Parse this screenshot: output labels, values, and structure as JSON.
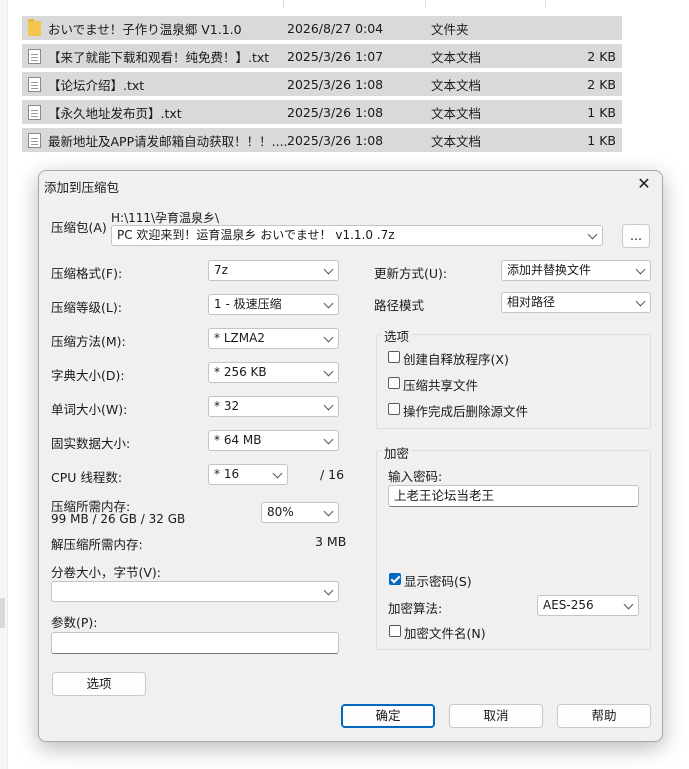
{
  "explorer": {
    "files": [
      {
        "name": "おいでませ！子作り温泉郷 V1.1.0",
        "date": "2026/8/27 0:04",
        "type": "文件夹",
        "size": "",
        "icon": "folder-icon"
      },
      {
        "name": "【来了就能下载和观看！纯免费！】.txt",
        "date": "2025/3/26 1:07",
        "type": "文本文档",
        "size": "2 KB",
        "icon": "text-file-icon"
      },
      {
        "name": "【论坛介绍】.txt",
        "date": "2025/3/26 1:08",
        "type": "文本文档",
        "size": "2 KB",
        "icon": "text-file-icon"
      },
      {
        "name": "【永久地址发布页】.txt",
        "date": "2025/3/26 1:08",
        "type": "文本文档",
        "size": "1 KB",
        "icon": "text-file-icon"
      },
      {
        "name": "最新地址及APP请发邮箱自动获取！！！....",
        "date": "2025/3/26 1:08",
        "type": "文本文档",
        "size": "1 KB",
        "icon": "text-file-icon"
      }
    ]
  },
  "dialog": {
    "title": "添加到压缩包",
    "close_glyph": "✕",
    "archive": {
      "label": "压缩包(A)",
      "path": "H:\\111\\孕育温泉乡\\",
      "filename": "PC 欢迎来到！运育温泉乡 おいでませ！ v1.1.0 .7z",
      "browse_label": "..."
    },
    "format": {
      "label": "压缩格式(F):",
      "value": "7z"
    },
    "level": {
      "label": "压缩等级(L):",
      "value": "1 - 极速压缩"
    },
    "method": {
      "label": "压缩方法(M):",
      "value": "*  LZMA2"
    },
    "dict": {
      "label": "字典大小(D):",
      "value": "*  256 KB"
    },
    "word": {
      "label": "单词大小(W):",
      "value": "*  32"
    },
    "solid": {
      "label": "固实数据大小:",
      "value": "*  64 MB"
    },
    "threads": {
      "label": "CPU 线程数:",
      "value": "*  16",
      "max": "/ 16"
    },
    "mem_compress": {
      "label": "压缩所需内存:",
      "detail": "99 MB / 26 GB / 32 GB",
      "percent": "80%"
    },
    "mem_decompress": {
      "label": "解压缩所需内存:",
      "value": "3 MB"
    },
    "volume": {
      "label": "分卷大小，字节(V):",
      "value": ""
    },
    "params": {
      "label": "参数(P):",
      "value": ""
    },
    "options_button": "选项",
    "update_mode": {
      "label": "更新方式(U):",
      "value": "添加并替换文件"
    },
    "path_mode": {
      "label": "路径模式",
      "value": "相对路径"
    },
    "options_group": {
      "title": "选项",
      "sfx": {
        "label": "创建自释放程序(X)",
        "checked": false
      },
      "shared": {
        "label": "压缩共享文件",
        "checked": false
      },
      "delete_after": {
        "label": "操作完成后删除源文件",
        "checked": false
      }
    },
    "encryption": {
      "title": "加密",
      "password_label": "输入密码:",
      "password": "上老王论坛当老王",
      "show_password": {
        "label": "显示密码(S)",
        "checked": true
      },
      "method_label": "加密算法:",
      "method": "AES-256",
      "encrypt_names": {
        "label": "加密文件名(N)",
        "checked": false
      }
    },
    "buttons": {
      "ok": "确定",
      "cancel": "取消",
      "help": "帮助"
    }
  }
}
